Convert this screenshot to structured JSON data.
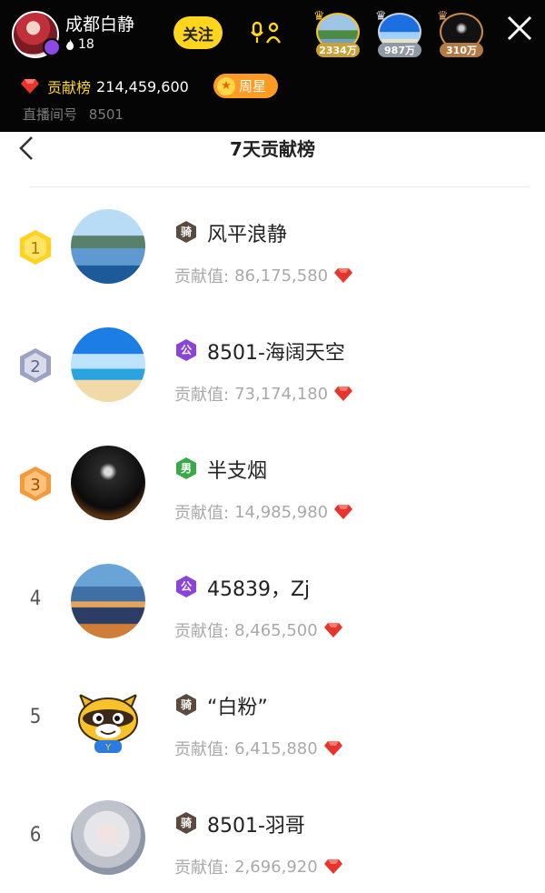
{
  "host": {
    "name": "成都白静",
    "fans": "18",
    "follow_label": "关注"
  },
  "viewers": [
    {
      "count": "2334万",
      "icon": "crown-icon"
    },
    {
      "count": "987万",
      "icon": "crown-icon"
    },
    {
      "count": "310万",
      "icon": "crown-icon"
    }
  ],
  "contribution": {
    "label": "贡献榜",
    "value": "214,459,600",
    "weekstar_label": "周星"
  },
  "room": {
    "label": "直播间号",
    "number": "8501"
  },
  "panel": {
    "title": "7天贡献榜"
  },
  "score_label": "贡献值:",
  "rankings": [
    {
      "rank": "1",
      "name": "风平浪静",
      "tag": "骑",
      "score": "86,175,580"
    },
    {
      "rank": "2",
      "name": "8501-海阔天空",
      "tag": "公",
      "score": "73,174,180"
    },
    {
      "rank": "3",
      "name": "半支烟",
      "tag": "男",
      "score": "14,985,980"
    },
    {
      "rank": "4",
      "name": "45839，Zj",
      "tag": "公",
      "score": "8,465,500"
    },
    {
      "rank": "5",
      "name": "“白粉”",
      "tag": "骑",
      "score": "6,415,880"
    },
    {
      "rank": "6",
      "name": "8501-羽哥",
      "tag": "骑",
      "score": "2,696,920"
    }
  ],
  "colors": {
    "accent_yellow": "#ffd51e",
    "weekstar_orange": "#ff9b23",
    "gem_red": "#e8342c",
    "tag_ride": "#5b4a3e",
    "tag_public": "#8a45d6",
    "tag_male": "#3aa94a"
  }
}
